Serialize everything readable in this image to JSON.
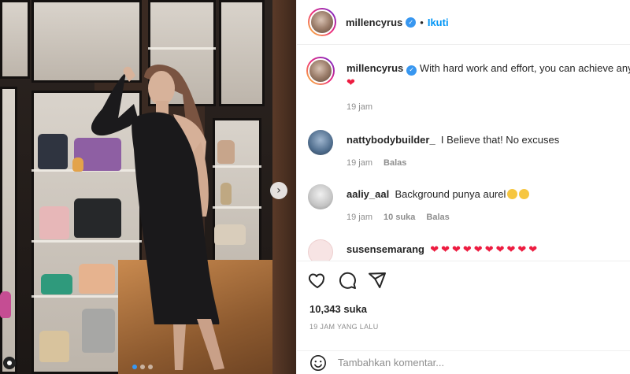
{
  "post": {
    "username": "millencyrus",
    "follow_label": "Ikuti",
    "separator": "•"
  },
  "photo": {
    "slide_count": 3,
    "active_slide": 1,
    "next_glyph": "›"
  },
  "comments": [
    {
      "username": "millencyrus",
      "text": "With hard work and effort, you can achieve any",
      "time": "19 jam",
      "suffix_heart": "❤"
    },
    {
      "username": "nattybodybuilder_",
      "text": "I Believe that! No excuses",
      "time": "19 jam",
      "reply": "Balas"
    },
    {
      "username": "aaliy_aal",
      "text": "Background punya aurel",
      "time": "19 jam",
      "likes": "10 suka",
      "reply": "Balas"
    },
    {
      "username": "susensemarang",
      "text": "❤❤❤❤❤❤❤❤❤❤"
    }
  ],
  "footer": {
    "likes": "10,343 suka",
    "time_ago": "19 JAM YANG LALU",
    "comment_placeholder": "Tambahkan komentar..."
  },
  "icons": {
    "like": "heart-icon",
    "comment": "comment-icon",
    "share": "share-icon",
    "emoji": "emoji-icon"
  },
  "colors": {
    "accent": "#0095f6",
    "verified": "#3897f0",
    "heart": "#ed1c40",
    "muted": "#8e8e8e"
  }
}
